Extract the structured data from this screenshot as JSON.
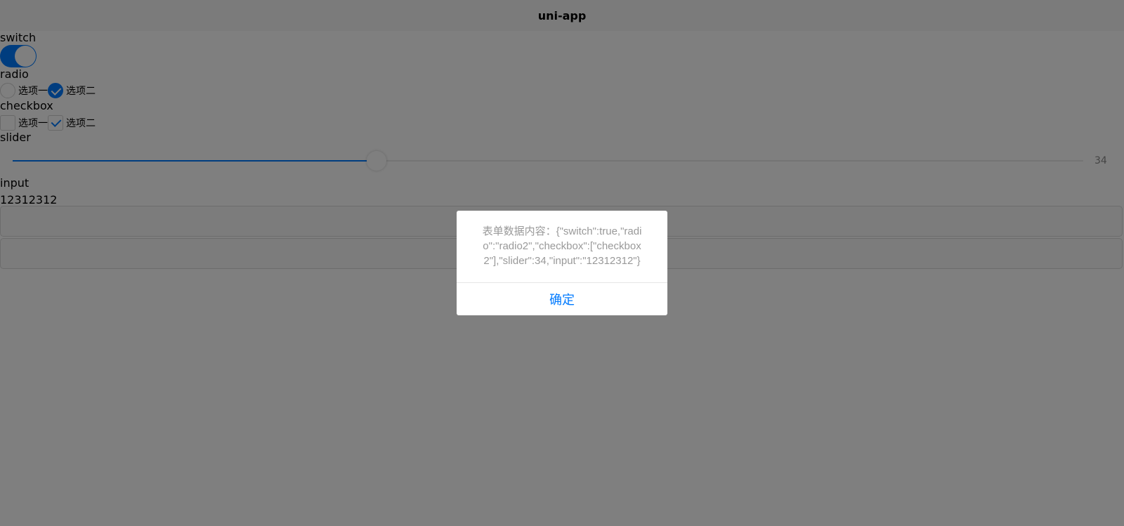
{
  "navbar": {
    "title": "uni-app"
  },
  "form": {
    "switch_label": "switch",
    "switch_on": true,
    "radio_label": "radio",
    "radio_options": [
      "选项一",
      "选项二"
    ],
    "radio_selected": "选项二",
    "checkbox_label": "checkbox",
    "checkbox_options": [
      "选项一",
      "选项二"
    ],
    "checkbox_checked": [
      "选项二"
    ],
    "slider_label": "slider",
    "slider_value": "34",
    "slider_percent": 34,
    "input_label": "input",
    "input_value": "12312312",
    "submit_label": "",
    "reset_label": ""
  },
  "modal": {
    "content": "表单数据内容：{\"switch\":true,\"radio\":\"radio2\",\"checkbox\":[\"checkbox2\"],\"slider\":34,\"input\":\"12312312\"}",
    "confirm_label": "确定"
  },
  "colors": {
    "accent": "#007aff",
    "mask": "rgba(0,0,0,0.5)"
  }
}
